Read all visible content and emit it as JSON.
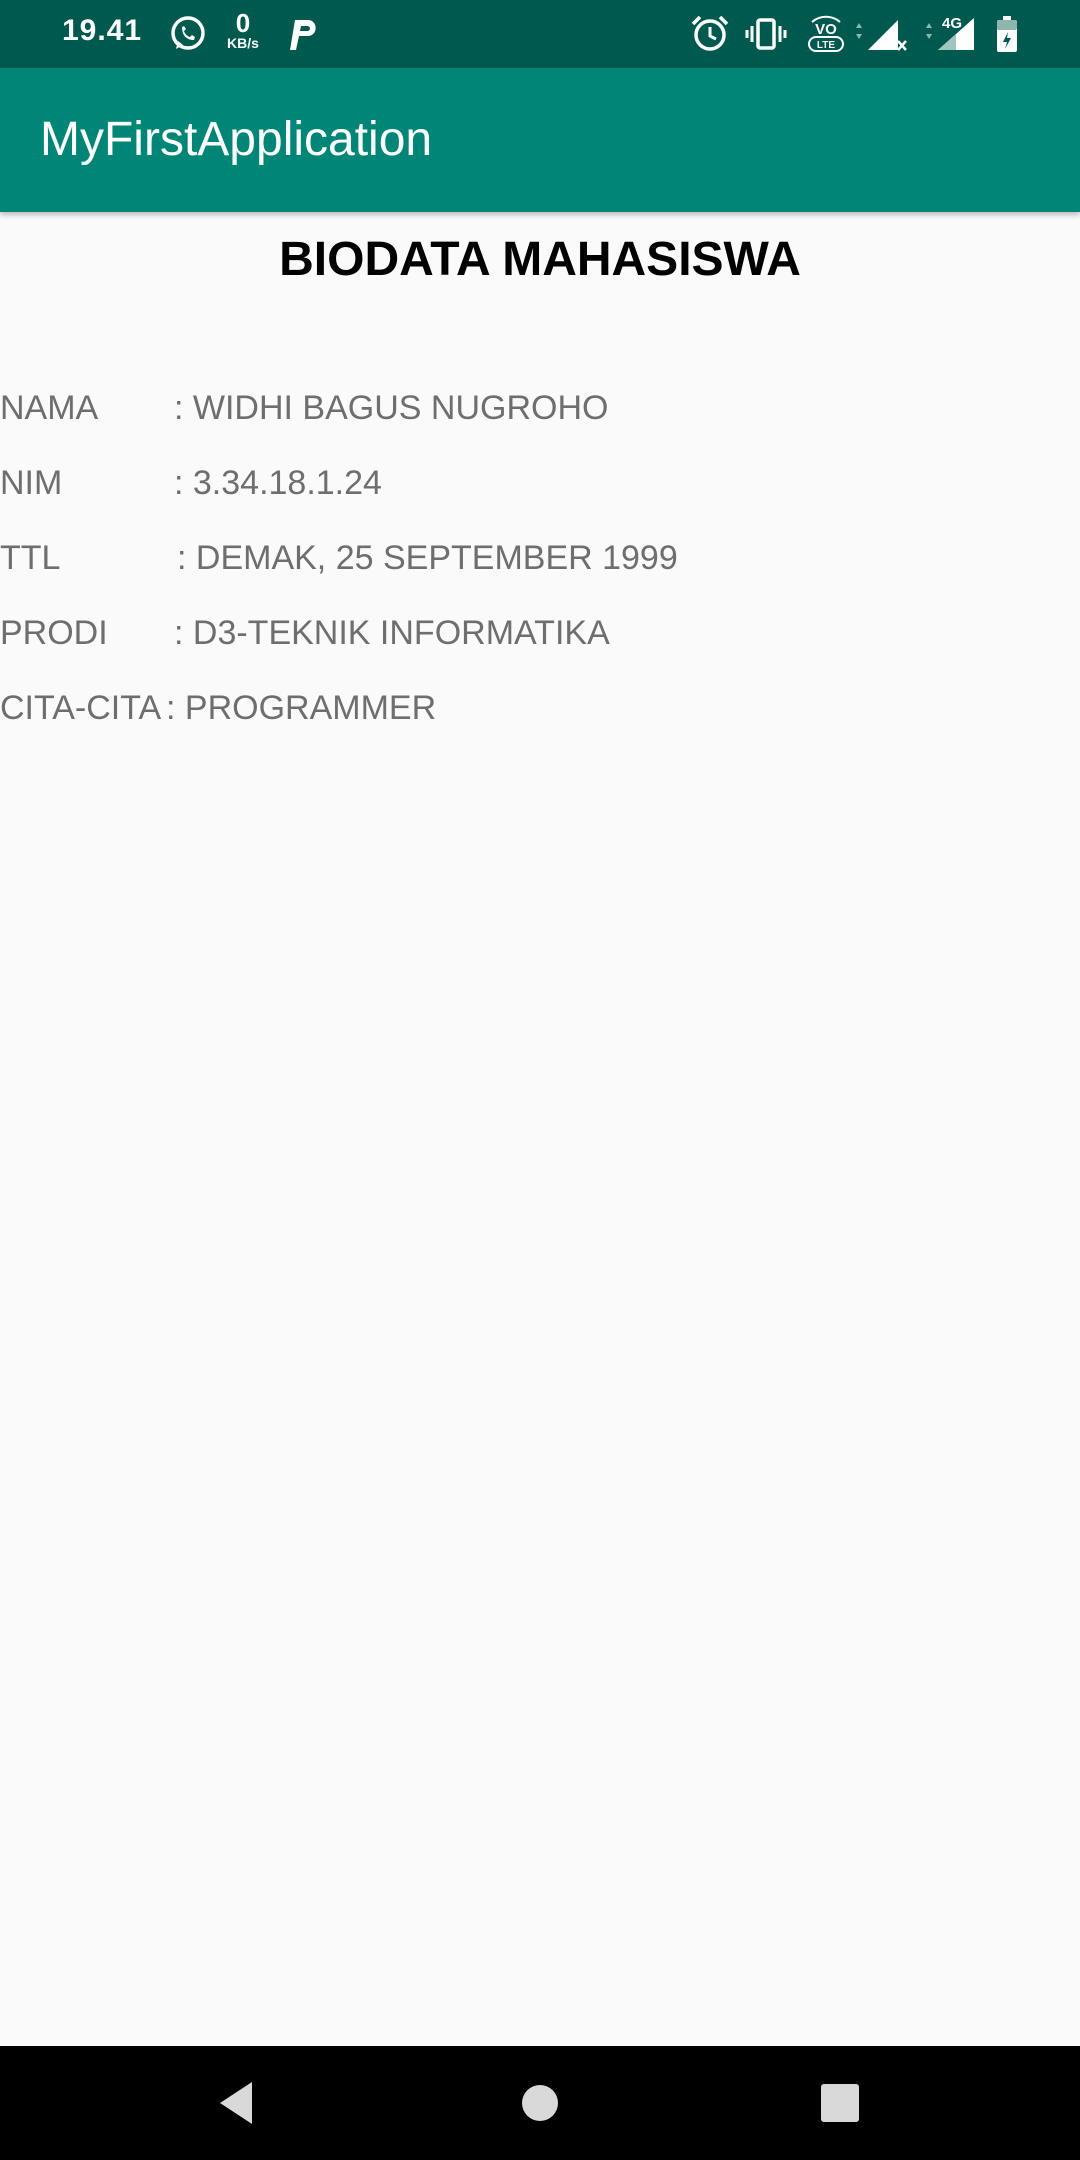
{
  "status_bar": {
    "time": "19.41",
    "network_speed_value": "0",
    "network_speed_unit": "KB/s",
    "network_type": "4G",
    "icons": [
      "whatsapp-icon",
      "parking-app-icon",
      "alarm-icon",
      "vibrate-icon",
      "volte-icon",
      "signal-icon",
      "signal-4g-icon",
      "battery-icon"
    ]
  },
  "app_bar": {
    "title": "MyFirstApplication",
    "color": "#008577"
  },
  "main": {
    "heading": "BIODATA MAHASISWA",
    "rows": [
      {
        "label": "NAMA",
        "value": ": WIDHI BAGUS NUGROHO"
      },
      {
        "label": "NIM",
        "value": ": 3.34.18.1.24"
      },
      {
        "label": "TTL",
        "value": ": DEMAK, 25 SEPTEMBER 1999"
      },
      {
        "label": "PRODI",
        "value": ": D3-TEKNIK INFORMATIKA"
      },
      {
        "label": "CITA-CITA",
        "value": ": PROGRAMMER"
      }
    ]
  },
  "nav_bar": {
    "buttons": [
      "back-icon",
      "home-icon",
      "recents-icon"
    ]
  }
}
